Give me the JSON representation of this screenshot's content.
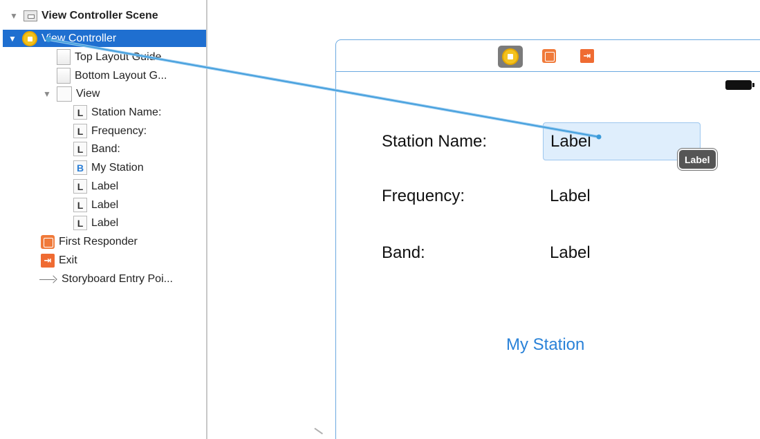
{
  "outline": {
    "scene_title": "View Controller Scene",
    "items": [
      {
        "label": "View Controller"
      },
      {
        "label": "Top Layout Guide"
      },
      {
        "label": "Bottom Layout G..."
      },
      {
        "label": "View"
      },
      {
        "label": "Station Name:",
        "badge": "L"
      },
      {
        "label": "Frequency:",
        "badge": "L"
      },
      {
        "label": "Band:",
        "badge": "L"
      },
      {
        "label": "My Station",
        "badge": "B"
      },
      {
        "label": "Label",
        "badge": "L"
      },
      {
        "label": "Label",
        "badge": "L"
      },
      {
        "label": "Label",
        "badge": "L"
      },
      {
        "label": "First Responder"
      },
      {
        "label": "Exit"
      },
      {
        "label": "Storyboard Entry Poi..."
      }
    ],
    "disclosure_glyph": "▼"
  },
  "scene": {
    "dock_exit_glyph": "⇥",
    "labels": {
      "station_name": "Station Name:",
      "frequency": "Frequency:",
      "band": "Band:"
    },
    "values": {
      "station_name": "Label",
      "frequency": "Label",
      "band": "Label"
    },
    "button": "My Station"
  },
  "tooltip": "Label",
  "colors": {
    "selection": "#1f6fd0",
    "canvas_border": "#6aa8e0",
    "connection_line": "#3a9ad9",
    "button_text": "#2a82d8",
    "view_controller_icon": "#f2c21b",
    "responder_icon": "#f07a3a"
  },
  "icons": {
    "scene": "scene-icon",
    "view_controller": "view-controller-icon",
    "layout_guide": "layout-guide-icon",
    "view": "view-icon",
    "label": "label-icon",
    "button": "button-icon",
    "first_responder": "first-responder-icon",
    "exit": "exit-icon",
    "entry_point": "entry-point-arrow-icon"
  }
}
